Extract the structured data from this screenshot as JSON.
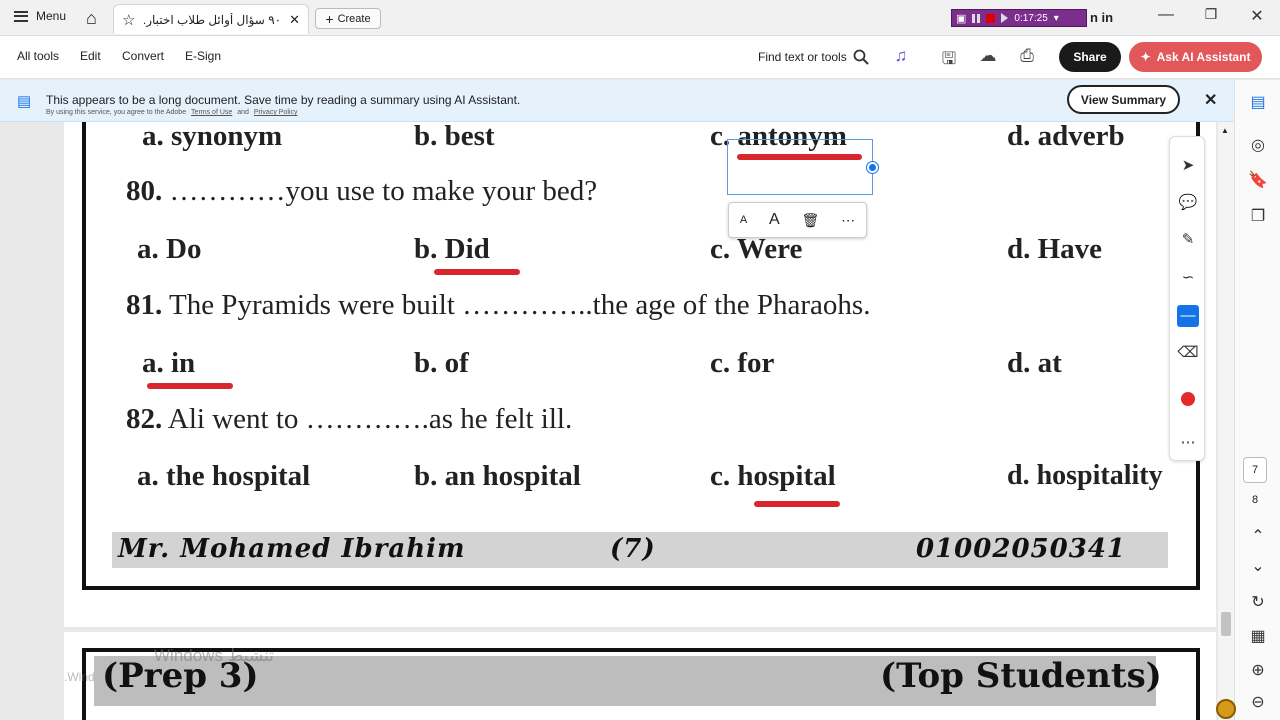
{
  "titlebar": {
    "menu_label": "Menu",
    "tab_title": "٩٠ سؤال أوائل طلاب اختبار...",
    "create_label": "Create",
    "recorder_time": "0:17:25",
    "signin_label": "n in"
  },
  "toolbar": {
    "items": [
      "All tools",
      "Edit",
      "Convert",
      "E-Sign"
    ],
    "find_label": "Find text or tools",
    "share_label": "Share",
    "ask_ai_label": "Ask AI Assistant"
  },
  "banner": {
    "message": "This appears to be a long document. Save time by reading a summary using AI Assistant.",
    "sub_prefix": "By using this service, you agree to the Adobe",
    "terms_link": "Terms of Use",
    "and_text": "and",
    "privacy_link": "Privacy Policy",
    "view_summary_label": "View Summary"
  },
  "rail": {
    "page_current": "7",
    "page_next": "8"
  },
  "document": {
    "prev_options": {
      "a": "a. synonym",
      "b": "b. best",
      "c_prefix": "c.",
      "c_answer": "antonym",
      "d": "d. adverb"
    },
    "questions": [
      {
        "number": "80.",
        "text": " …………you use to make your bed?",
        "a": "a. Do",
        "b_prefix": "b.",
        "b_answer": "Did",
        "c": "c. Were",
        "d": "d. Have"
      },
      {
        "number": "81.",
        "text": " The Pyramids were built …………..the age of the Pharaohs.",
        "a_prefix": "a.",
        "a_answer": "in",
        "b": "b. of",
        "c": "c. for",
        "d": "d. at"
      },
      {
        "number": "82.",
        "text": " Ali went to ………….as he felt ill.",
        "a": "a. the hospital",
        "b": "b. an hospital",
        "c_prefix": "c.",
        "c_answer": "hospital",
        "d": "d. hospitality"
      }
    ],
    "footer": {
      "author": "Mr. Mohamed Ibrahim",
      "page": "(7)",
      "phone": "01002050341"
    },
    "next_page_header": {
      "left": "(Prep 3)",
      "right": "(Top Students)"
    }
  },
  "watermark": {
    "line1": "Windows تنشيط",
    "line2": ".Wind"
  },
  "colors": {
    "annotation_red": "#d8262c",
    "ai_button": "#e2575a",
    "active_tool": "#1473e6"
  }
}
